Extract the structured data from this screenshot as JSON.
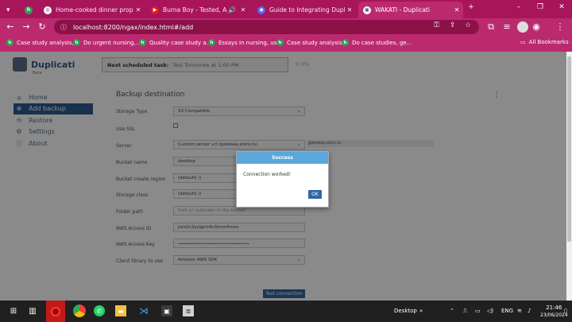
{
  "tabs": [
    {
      "title": "Home-cooked dinner proposal",
      "icon": "h-icon"
    },
    {
      "title": "Burna Boy - Tested, Approv",
      "icon": "youtube-icon"
    },
    {
      "title": "Guide to Integrating Duplicati t",
      "icon": "discord-icon"
    },
    {
      "title": "WAKATI - Duplicati",
      "icon": "duplicati-icon"
    }
  ],
  "omnibox": {
    "url": "localhost:8200/ngax/index.html#/add"
  },
  "bookmarks": [
    {
      "label": "Case study analysis,..."
    },
    {
      "label": "Do urgent nursing,..."
    },
    {
      "label": "Quality case study a..."
    },
    {
      "label": "Essays in nursing, us..."
    },
    {
      "label": "Case study analysis,..."
    },
    {
      "label": "Do case studies, ge..."
    }
  ],
  "all_bookmarks": "All Bookmarks",
  "app": {
    "name": "Duplicati",
    "beta": "Beta",
    "schedule_label": "Next scheduled task:",
    "schedule_value": "Test Tomorrow at 1:00 PM",
    "pause_label": "II 0%"
  },
  "sidebar": [
    {
      "label": "Home",
      "icon": "home-icon"
    },
    {
      "label": "Add backup",
      "icon": "plus-icon"
    },
    {
      "label": "Restore",
      "icon": "restore-icon"
    },
    {
      "label": "Settings",
      "icon": "gear-icon"
    },
    {
      "label": "About",
      "icon": "info-icon"
    }
  ],
  "form": {
    "title": "Backup destination",
    "rows": [
      {
        "label": "Storage Type",
        "value": "S3 Compatible"
      },
      {
        "label": "Use SSL",
        "value": ""
      },
      {
        "label": "Server",
        "value": "Custom server url (gateway.storx.io)"
      },
      {
        "label": "Bucket name",
        "value": "desktop"
      },
      {
        "label": "Bucket create region",
        "value": "(default) ()"
      },
      {
        "label": "Storage class",
        "value": "(default) ()"
      },
      {
        "label": "Folder path",
        "value": "Path or subfolder in the bucket"
      },
      {
        "label": "AWS Access ID",
        "value": "jurs2c3yyqprs4v3mov4moo"
      },
      {
        "label": "AWS Access Key",
        "value": "••••••••••••••••••••••••••••••••••••••••••••••••"
      },
      {
        "label": "Client library to use",
        "value": "Amazon AWS SDK"
      }
    ],
    "server_hint": "gateway.storx.io",
    "test_button": "Test connection"
  },
  "modal": {
    "title": "Success",
    "message": "Connection worked!",
    "ok": "OK"
  },
  "taskbar": {
    "desktop": "Desktop",
    "lang": "ENG",
    "time": "21:46",
    "date": "23/06/2024"
  },
  "colors": {
    "chrome": "#a8155a",
    "accent": "#2e67a6",
    "modal_header": "#5aa7dc"
  }
}
